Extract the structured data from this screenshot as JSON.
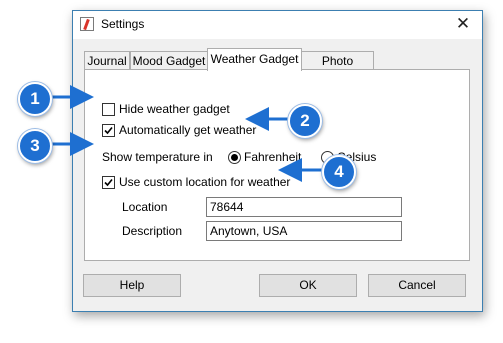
{
  "window": {
    "title": "Settings",
    "close_glyph": "✕"
  },
  "tabs": [
    {
      "label": "Journal",
      "active": false
    },
    {
      "label": "Mood Gadget",
      "active": false
    },
    {
      "label": "Weather Gadget",
      "active": true
    },
    {
      "label": "Photo Gadget",
      "active": false
    }
  ],
  "weather": {
    "hide_gadget_label": "Hide weather gadget",
    "hide_gadget_checked": false,
    "auto_get_label": "Automatically get weather",
    "auto_get_checked": true,
    "temp_label": "Show temperature in",
    "fahrenheit_label": "Fahrenheit",
    "fahrenheit_selected": true,
    "celsius_label": "Celsius",
    "celsius_selected": false,
    "custom_location_label": "Use custom location for weather",
    "custom_location_checked": true,
    "location_label": "Location",
    "location_value": "78644",
    "description_label": "Description",
    "description_value": "Anytown, USA"
  },
  "buttons": {
    "help": "Help",
    "ok": "OK",
    "cancel": "Cancel"
  },
  "callouts": [
    "1",
    "2",
    "3",
    "4"
  ],
  "colors": {
    "callout": "#1e6fd1",
    "window_border": "#3c7fb1",
    "dialog_bg": "#f0f0f0"
  },
  "icons": {
    "app": "journal-app-icon",
    "check": "checkmark-icon",
    "arrow": "callout-arrow-icon"
  }
}
